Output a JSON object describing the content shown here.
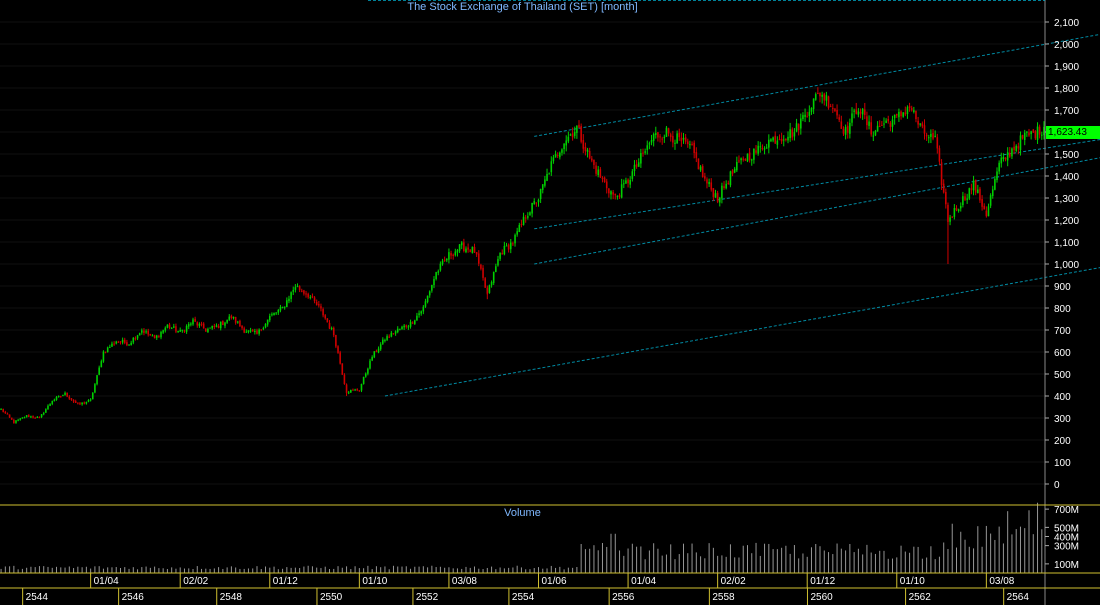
{
  "chart_data": {
    "type": "candlestick",
    "title": "The Stock Exchange of Thailand (SET) [month]",
    "price_axis": {
      "ylim": [
        0,
        2150
      ],
      "ticks": [
        0,
        100,
        200,
        300,
        400,
        500,
        600,
        700,
        800,
        900,
        1000,
        1100,
        1200,
        1300,
        1400,
        1500,
        1600,
        1700,
        1800,
        1900,
        2000,
        2100
      ],
      "tick_labels": [
        "0",
        "100",
        "200",
        "300",
        "400",
        "500",
        "600",
        "700",
        "800",
        "900",
        "1,000",
        "1,100",
        "1,200",
        "1,300",
        "1,400",
        "1,500",
        "1,600",
        "1,700",
        "1,800",
        "1,900",
        "2,000",
        "2,100"
      ]
    },
    "last_price_label": "1,623.43",
    "last_price": 1623.43,
    "close_anchors": [
      [
        0,
        340
      ],
      [
        6,
        280
      ],
      [
        12,
        310
      ],
      [
        18,
        300
      ],
      [
        24,
        380
      ],
      [
        30,
        410
      ],
      [
        36,
        360
      ],
      [
        42,
        380
      ],
      [
        48,
        600
      ],
      [
        54,
        650
      ],
      [
        60,
        640
      ],
      [
        66,
        700
      ],
      [
        72,
        660
      ],
      [
        78,
        720
      ],
      [
        84,
        690
      ],
      [
        90,
        740
      ],
      [
        96,
        700
      ],
      [
        102,
        720
      ],
      [
        108,
        760
      ],
      [
        114,
        700
      ],
      [
        120,
        680
      ],
      [
        126,
        760
      ],
      [
        132,
        800
      ],
      [
        138,
        900
      ],
      [
        144,
        860
      ],
      [
        150,
        790
      ],
      [
        156,
        680
      ],
      [
        162,
        420
      ],
      [
        168,
        430
      ],
      [
        174,
        580
      ],
      [
        180,
        660
      ],
      [
        186,
        700
      ],
      [
        192,
        730
      ],
      [
        198,
        800
      ],
      [
        204,
        960
      ],
      [
        210,
        1040
      ],
      [
        216,
        1080
      ],
      [
        222,
        1060
      ],
      [
        228,
        860
      ],
      [
        234,
        1050
      ],
      [
        240,
        1100
      ],
      [
        246,
        1220
      ],
      [
        252,
        1300
      ],
      [
        258,
        1450
      ],
      [
        264,
        1560
      ],
      [
        270,
        1620
      ],
      [
        276,
        1480
      ],
      [
        282,
        1380
      ],
      [
        288,
        1300
      ],
      [
        294,
        1380
      ],
      [
        300,
        1480
      ],
      [
        306,
        1580
      ],
      [
        312,
        1600
      ],
      [
        318,
        1560
      ],
      [
        324,
        1520
      ],
      [
        330,
        1380
      ],
      [
        336,
        1300
      ],
      [
        342,
        1400
      ],
      [
        348,
        1480
      ],
      [
        354,
        1510
      ],
      [
        360,
        1560
      ],
      [
        366,
        1580
      ],
      [
        372,
        1600
      ],
      [
        378,
        1700
      ],
      [
        384,
        1780
      ],
      [
        390,
        1720
      ],
      [
        396,
        1600
      ],
      [
        402,
        1720
      ],
      [
        408,
        1600
      ],
      [
        414,
        1640
      ],
      [
        420,
        1660
      ],
      [
        426,
        1720
      ],
      [
        432,
        1600
      ],
      [
        438,
        1560
      ],
      [
        444,
        1200
      ],
      [
        450,
        1280
      ],
      [
        456,
        1360
      ],
      [
        462,
        1230
      ],
      [
        468,
        1450
      ],
      [
        474,
        1520
      ],
      [
        480,
        1580
      ],
      [
        486,
        1600
      ],
      [
        489,
        1623
      ]
    ],
    "channel_lines": [
      {
        "from": [
          180,
          400
        ],
        "to": [
          520,
          1000
        ]
      },
      {
        "from": [
          250,
          1160
        ],
        "to": [
          520,
          1580
        ]
      },
      {
        "from": [
          250,
          1000
        ],
        "to": [
          520,
          1500
        ]
      },
      {
        "from": [
          250,
          1580
        ],
        "to": [
          520,
          2060
        ]
      }
    ],
    "time_axis": {
      "month_labels": [
        "01/04",
        "02/02",
        "01/12",
        "01/10",
        "03/08",
        "01/06",
        "01/04",
        "02/02",
        "01/12",
        "01/10",
        "03/08"
      ],
      "month_positions": [
        42,
        84,
        126,
        168,
        210,
        252,
        294,
        336,
        378,
        420,
        462
      ],
      "year_labels": [
        "2544",
        "2546",
        "2548",
        "2550",
        "2552",
        "2554",
        "2556",
        "2558",
        "2560",
        "2562",
        "2564"
      ],
      "year_positions": [
        12,
        57,
        103,
        150,
        195,
        240,
        287,
        334,
        380,
        426,
        472
      ]
    },
    "volume": {
      "title": "Volume",
      "ylim": [
        0,
        800
      ],
      "ticks": [
        100,
        300,
        400,
        500,
        700
      ],
      "tick_labels": [
        "100M",
        "300M",
        "400M",
        "500M",
        "700M"
      ]
    },
    "colors": {
      "up": "#00d000",
      "down": "#d00000",
      "grid": "#ffffff",
      "channel": "#00b8d8",
      "axis_text": "#ffffff",
      "title_text": "#7fb8ff",
      "frame": "#d0c030",
      "last_price_bg": "#00ff00"
    }
  }
}
